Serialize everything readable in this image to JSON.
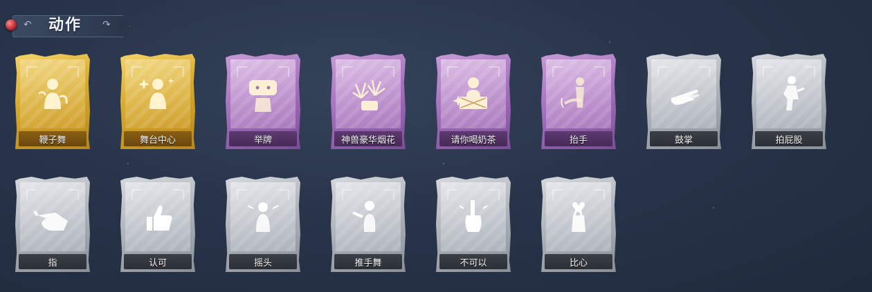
{
  "header": {
    "title": "动作",
    "back_arrow": "↶",
    "forward_arrow": "↷"
  },
  "rows": [
    [
      {
        "label": "鞭子舞",
        "tier": "gold",
        "icon": "whip-dance-icon"
      },
      {
        "label": "舞台中心",
        "tier": "gold",
        "icon": "center-stage-icon"
      },
      {
        "label": "举牌",
        "tier": "purple",
        "icon": "hold-sign-icon"
      },
      {
        "label": "神兽豪华烟花",
        "tier": "purple",
        "icon": "fireworks-icon"
      },
      {
        "label": "请你喝奶茶",
        "tier": "purple",
        "icon": "milk-tea-icon"
      },
      {
        "label": "抬手",
        "tier": "purple",
        "icon": "raise-hand-icon"
      },
      {
        "label": "鼓掌",
        "tier": "grey",
        "icon": "clap-icon"
      },
      {
        "label": "拍屁股",
        "tier": "grey",
        "icon": "pat-icon"
      }
    ],
    [
      {
        "label": "指",
        "tier": "grey",
        "icon": "point-icon"
      },
      {
        "label": "认可",
        "tier": "grey",
        "icon": "thumbs-up-icon"
      },
      {
        "label": "摇头",
        "tier": "grey",
        "icon": "shake-head-icon"
      },
      {
        "label": "推手舞",
        "tier": "grey",
        "icon": "push-dance-icon"
      },
      {
        "label": "不可以",
        "tier": "grey",
        "icon": "finger-wag-icon"
      },
      {
        "label": "比心",
        "tier": "grey",
        "icon": "heart-hand-icon"
      }
    ]
  ],
  "colors": {
    "gold_icon": "#fff3d0",
    "purple_icon": "#fbefd6",
    "grey_icon": "#ffffff"
  }
}
